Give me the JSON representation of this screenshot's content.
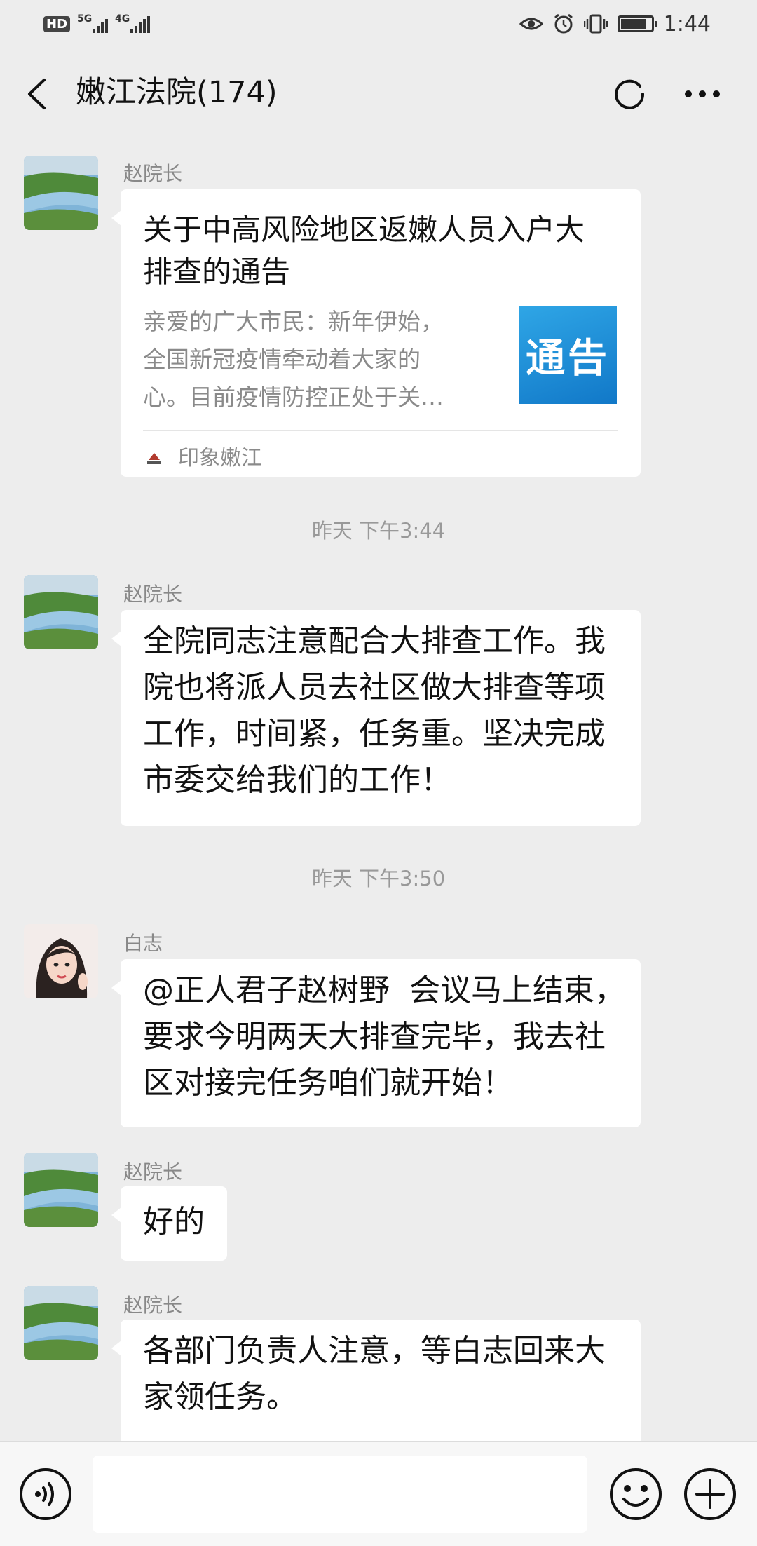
{
  "status_bar": {
    "hd_label": "HD",
    "sim1_label": "5G",
    "sim2_label": "4G",
    "time": "1:44",
    "battery_level": 0.85,
    "icons": [
      "eye-icon",
      "alarm-icon",
      "vibrate-icon",
      "battery-icon"
    ]
  },
  "header": {
    "title": "嫩江法院(174)",
    "icons": [
      "back-arrow-icon",
      "refresh-icon",
      "more-icon"
    ]
  },
  "messages": [
    {
      "type": "article",
      "sender": "赵院长",
      "title": "关于中高风险地区返嫩人员入户大\n排查的通告",
      "description": "亲爱的广大市民：新年伊始，\n全国新冠疫情牵动着大家的\n心。目前疫情防控正处于关…",
      "thumbnail_text": "通告",
      "source": "印象嫩江"
    },
    {
      "type": "time",
      "text": "昨天 下午3:44"
    },
    {
      "type": "text",
      "sender": "赵院长",
      "text": "全院同志注意配合大排查工作。我\n院也将派人员去社区做大排查等项\n工作，时间紧，任务重。坚决完成\n市委交给我们的工作！"
    },
    {
      "type": "time",
      "text": "昨天 下午3:50"
    },
    {
      "type": "text",
      "sender": "白志",
      "text": "@正人君子赵树野  会议马上结束，\n要求今明两天大排查完毕，我去社\n区对接完任务咱们就开始！"
    },
    {
      "type": "text",
      "sender": "赵院长",
      "text": "好的"
    },
    {
      "type": "text",
      "sender": "赵院长",
      "text": "各部门负责人注意，等白志回来大\n家领任务。"
    }
  ],
  "input_bar": {
    "input_value": "",
    "icons": [
      "voice-icon",
      "emoji-icon",
      "plus-icon"
    ]
  },
  "colors": {
    "background": "#ededed",
    "bubble": "#ffffff",
    "accent_thumb": "#1e8fd8"
  }
}
